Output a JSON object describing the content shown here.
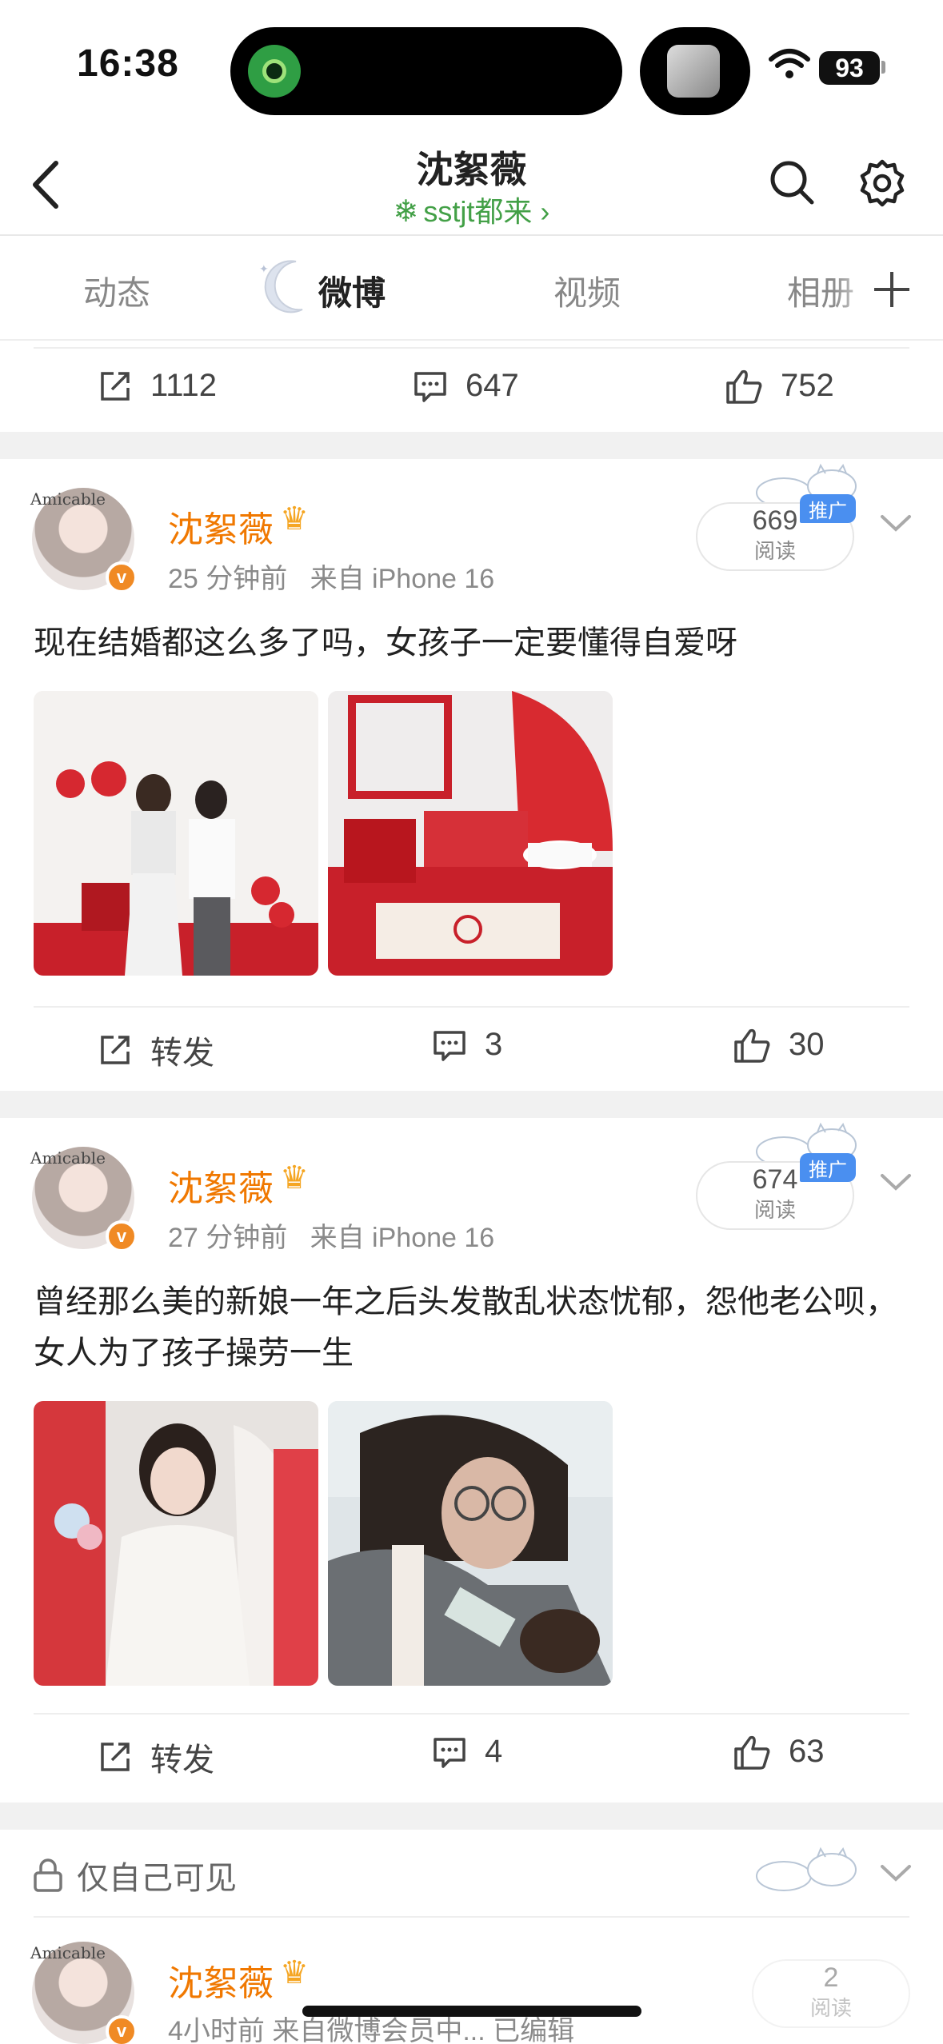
{
  "status_bar": {
    "time": "16:38",
    "battery": "93"
  },
  "header": {
    "title": "沈絮薇",
    "subtitle": "sstjt都来 ›",
    "subtitle_icon": "snowflake-icon"
  },
  "tabs": [
    {
      "label": "动态"
    },
    {
      "label": "微博",
      "active": true
    },
    {
      "label": "视频"
    },
    {
      "label": "相册"
    }
  ],
  "top_actions": {
    "repost": "1112",
    "comments": "647",
    "likes": "752"
  },
  "posts": [
    {
      "author": "沈絮薇",
      "avatar_text": "Amicable",
      "time": "25 分钟前",
      "source": "来自 iPhone 16",
      "read_count": "669",
      "read_label": "阅读",
      "promo": "推广",
      "text": "现在结婚都这么多了吗，女孩子一定要懂得自爱呀",
      "images": [
        "couple-engagement-photo",
        "red-engagement-table-photo"
      ],
      "repost_label": "转发",
      "comments": "3",
      "likes": "30"
    },
    {
      "author": "沈絮薇",
      "avatar_text": "Amicable",
      "time": "27 分钟前",
      "source": "来自 iPhone 16",
      "read_count": "674",
      "read_label": "阅读",
      "promo": "推广",
      "text": "曾经那么美的新娘一年之后头发散乱状态忧郁，怨他老公呗，女人为了孩子操劳一生",
      "images": [
        "bride-photo",
        "mother-feeding-baby-photo"
      ],
      "repost_label": "转发",
      "comments": "4",
      "likes": "63"
    }
  ],
  "private_section": {
    "label": "仅自己可见"
  },
  "bottom_post": {
    "author": "沈絮薇",
    "avatar_text": "Amicable",
    "meta": "4小时前  来自微博会员中...  已编辑",
    "read_count": "2",
    "read_label": "阅读"
  },
  "colors": {
    "author": "#f07800",
    "accent_green": "#43a047",
    "promo_blue": "#4a8ff0"
  }
}
